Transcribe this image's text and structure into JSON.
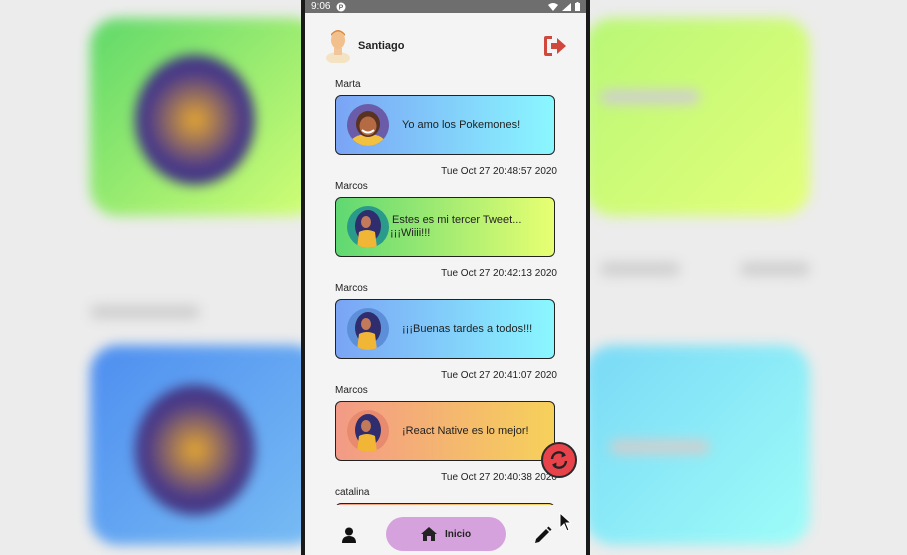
{
  "status_bar": {
    "time": "9:06"
  },
  "header": {
    "username": "Santiago"
  },
  "posts": [
    {
      "author": "Marta",
      "message": "Yo amo los Pokemones!",
      "date": "Tue Oct 27 20:48:57 2020"
    },
    {
      "author": "Marcos",
      "message": "Estes es mi tercer Tweet...",
      "message_line2": "¡¡¡Wiiii!!!",
      "date": "Tue Oct 27 20:42:13 2020"
    },
    {
      "author": "Marcos",
      "message": "¡¡¡Buenas tardes a todos!!!",
      "date": "Tue Oct 27 20:41:07 2020"
    },
    {
      "author": "Marcos",
      "message": "¡React Native es lo mejor!",
      "date": "Tue Oct 27 20:40:38 2020"
    },
    {
      "author": "catalina"
    }
  ],
  "bottom_nav": {
    "home_label": "Inicio"
  },
  "icons": {
    "logout": "logout-icon",
    "refresh": "refresh-icon",
    "profile": "user-icon",
    "home": "home-icon",
    "write": "pencil-icon"
  },
  "colors": {
    "accent_refresh": "#e8434b",
    "nav_active": "#d6a2dd",
    "logout": "#d0473c"
  }
}
